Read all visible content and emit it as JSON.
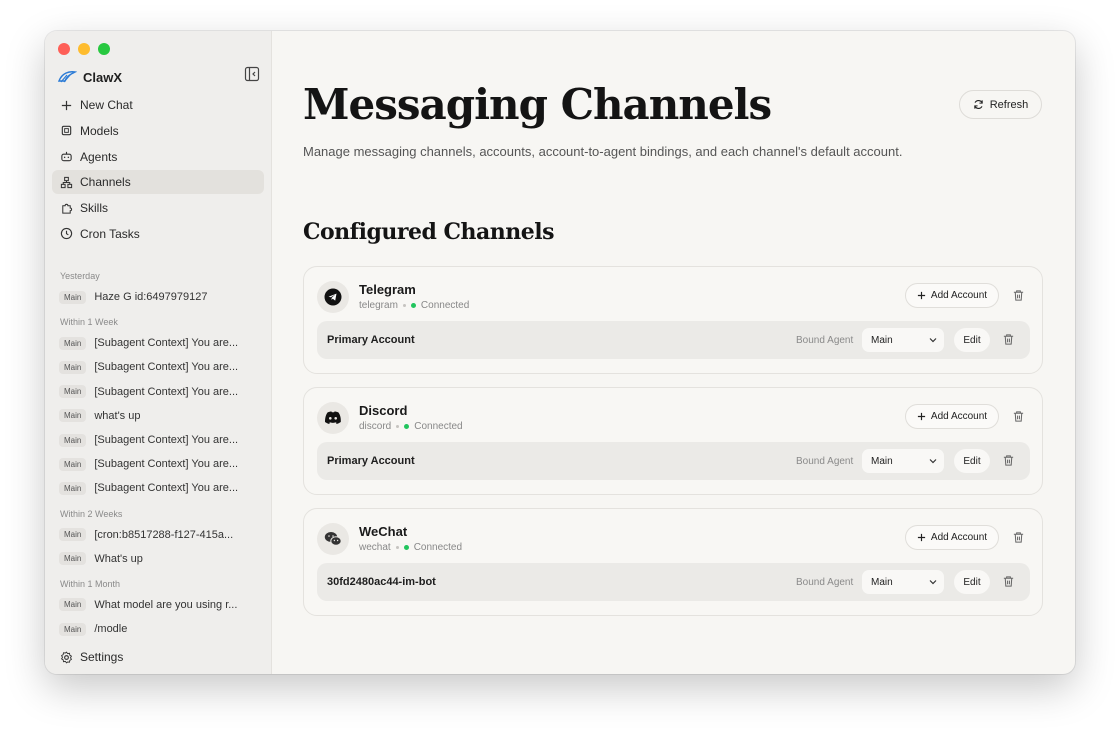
{
  "app": {
    "name": "ClawX"
  },
  "sidebar": {
    "nav": [
      {
        "label": "New Chat",
        "icon": "plus-icon"
      },
      {
        "label": "Models",
        "icon": "cpu-icon"
      },
      {
        "label": "Agents",
        "icon": "bot-icon"
      },
      {
        "label": "Channels",
        "icon": "network-icon"
      },
      {
        "label": "Skills",
        "icon": "puzzle-icon"
      },
      {
        "label": "Cron Tasks",
        "icon": "clock-icon"
      }
    ],
    "history": [
      {
        "group": "Yesterday",
        "items": [
          {
            "tag": "Main",
            "title": "Haze G id:6497979127"
          }
        ]
      },
      {
        "group": "Within 1 Week",
        "items": [
          {
            "tag": "Main",
            "title": "[Subagent Context] You are..."
          },
          {
            "tag": "Main",
            "title": "[Subagent Context] You are..."
          },
          {
            "tag": "Main",
            "title": "[Subagent Context] You are..."
          },
          {
            "tag": "Main",
            "title": "what's up"
          },
          {
            "tag": "Main",
            "title": "[Subagent Context] You are..."
          },
          {
            "tag": "Main",
            "title": "[Subagent Context] You are..."
          },
          {
            "tag": "Main",
            "title": "[Subagent Context] You are..."
          }
        ]
      },
      {
        "group": "Within 2 Weeks",
        "items": [
          {
            "tag": "Main",
            "title": "[cron:b8517288-f127-415a..."
          },
          {
            "tag": "Main",
            "title": "What's up"
          }
        ]
      },
      {
        "group": "Within 1 Month",
        "items": [
          {
            "tag": "Main",
            "title": "What model are you using r..."
          },
          {
            "tag": "Main",
            "title": "/modle"
          }
        ]
      }
    ],
    "settings_label": "Settings"
  },
  "main": {
    "title": "Messaging Channels",
    "refresh_label": "Refresh",
    "subtitle": "Manage messaging channels, accounts, account-to-agent bindings, and each channel's default account.",
    "section_title": "Configured Channels",
    "add_account_label": "Add Account",
    "bound_agent_label": "Bound Agent",
    "edit_label": "Edit",
    "channels": [
      {
        "name": "Telegram",
        "id": "telegram",
        "status": "Connected",
        "icon": "telegram-icon",
        "account": {
          "name": "Primary Account",
          "agent": "Main"
        }
      },
      {
        "name": "Discord",
        "id": "discord",
        "status": "Connected",
        "icon": "discord-icon",
        "account": {
          "name": "Primary Account",
          "agent": "Main"
        }
      },
      {
        "name": "WeChat",
        "id": "wechat",
        "status": "Connected",
        "icon": "wechat-icon",
        "account": {
          "name": "30fd2480ac44-im-bot",
          "agent": "Main"
        }
      }
    ]
  },
  "colors": {
    "connected": "#22c55e",
    "sidebar_bg": "#efeeec",
    "main_bg": "#f7f6f3"
  }
}
